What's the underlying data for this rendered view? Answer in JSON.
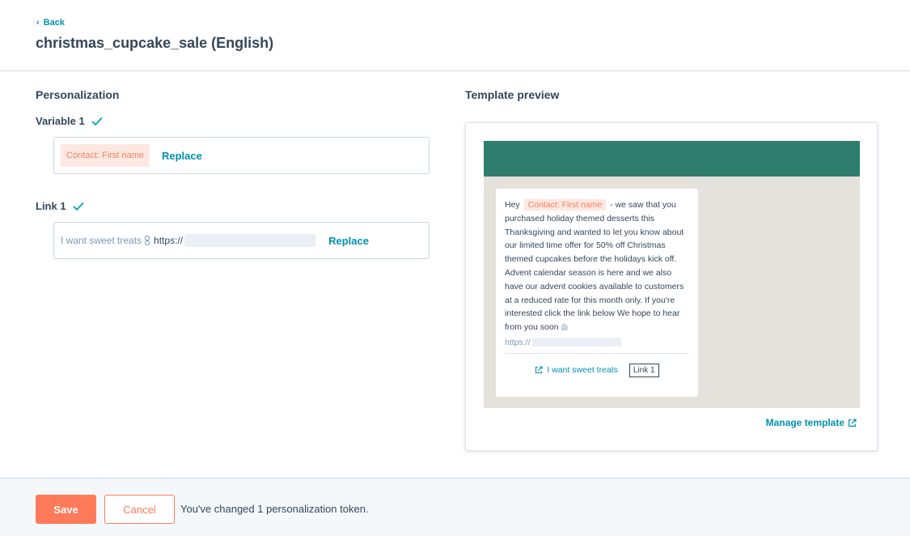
{
  "header": {
    "back_label": "Back",
    "title": "christmas_cupcake_sale (English)"
  },
  "personalization": {
    "section_title": "Personalization",
    "variable1": {
      "label": "Variable 1",
      "token": "Contact: First name",
      "replace_label": "Replace"
    },
    "link1": {
      "label": "Link 1",
      "text": "I want sweet treats",
      "url": "https://",
      "replace_label": "Replace"
    }
  },
  "preview": {
    "section_title": "Template preview",
    "message": {
      "greeting": "Hey",
      "token": "Contact: First name",
      "body": "- we saw that you purchased holiday themed desserts this Thanksgiving and wanted to let you know about our limited time offer for 50% off Christmas themed cupcakes before the holidays kick off. Advent calendar season is here and we also have our advent cookies available to customers at a reduced rate for this month only. If you're interested click the link below We hope to hear from you soon",
      "url": "https://",
      "link_label": "I want sweet treats",
      "link_badge": "Link 1"
    },
    "manage_label": "Manage template",
    "banner_color": "#2e7d6d"
  },
  "footer": {
    "save_label": "Save",
    "cancel_label": "Cancel",
    "status": "You've changed 1 personalization token."
  },
  "colors": {
    "accent": "#ff7a59",
    "link": "#0091ae",
    "success": "#00a4bd"
  }
}
